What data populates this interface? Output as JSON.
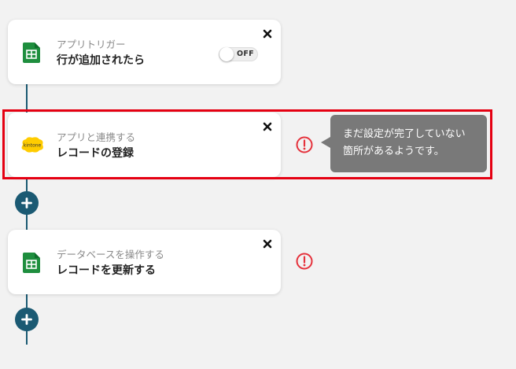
{
  "steps": [
    {
      "subtitle": "アプリトリガー",
      "title": "行が追加されたら",
      "icon": "google-sheets-icon",
      "toggle_label": "OFF"
    },
    {
      "subtitle": "アプリと連携する",
      "title": "レコードの登録",
      "icon": "kintone-icon",
      "logo_text": "kintone"
    },
    {
      "subtitle": "データベースを操作する",
      "title": "レコードを更新する",
      "icon": "google-sheets-icon"
    }
  ],
  "tooltip": {
    "line1": "まだ設定が完了していない",
    "line2": "箇所があるようです。"
  },
  "colors": {
    "flow_line": "#1b5a73",
    "add_button": "#1b5a73",
    "sheets_green": "#1e8e3e",
    "warning_red": "#e5323c",
    "highlight_red": "#e50012",
    "kintone_yellow": "#ffcc00",
    "tooltip_bg": "#797979"
  }
}
